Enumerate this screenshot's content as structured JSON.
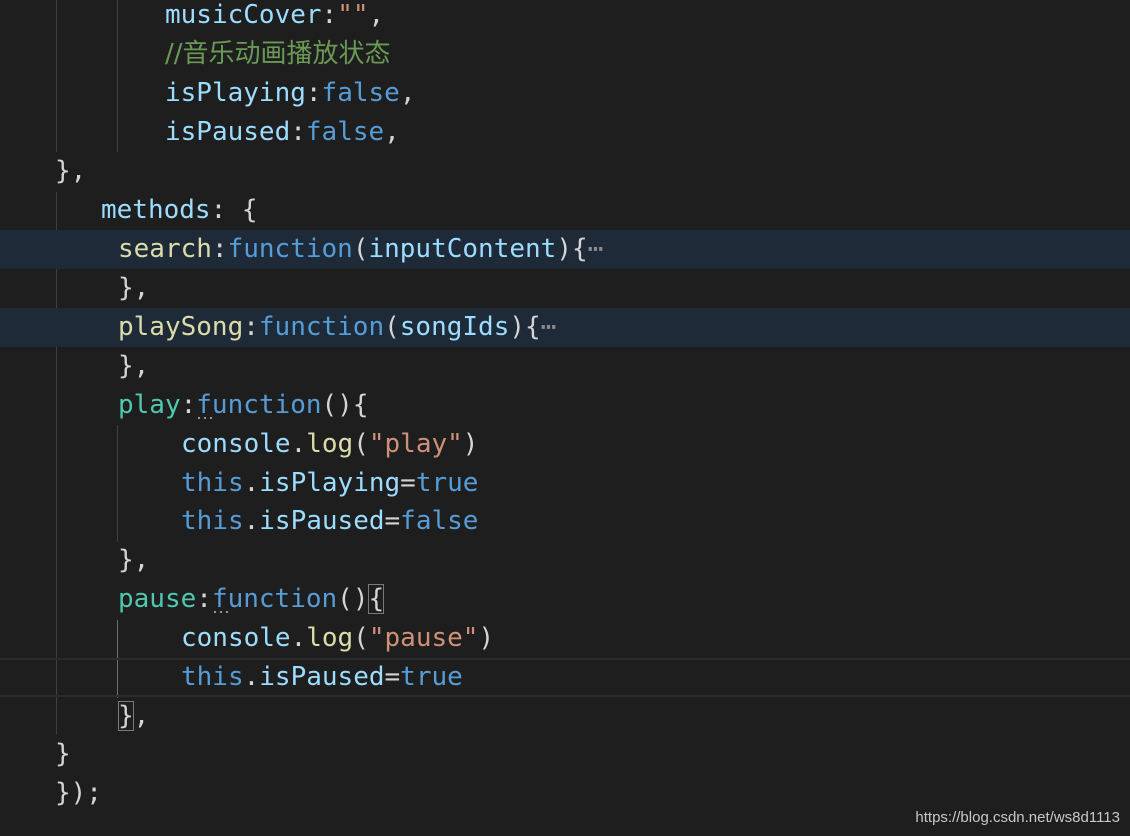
{
  "editor": {
    "lines": {
      "l1": {
        "key": "musicCover",
        "colon": ":",
        "str": "\"\"",
        "comma": ","
      },
      "l2": {
        "comment": "//音乐动画播放状态"
      },
      "l3": {
        "key": "isPlaying",
        "colon": ":",
        "value": "false",
        "comma": ","
      },
      "l4": {
        "key": "isPaused",
        "colon": ":",
        "value": "false",
        "comma": ","
      },
      "l5": {
        "text": "},"
      },
      "l6": {
        "key": "methods",
        "rest": ": {"
      },
      "l7": {
        "name": "search",
        "colon": ":",
        "kw": "function",
        "paren_open": "(",
        "param": "inputContent",
        "paren_close": "){",
        "fold": "⋯"
      },
      "l8": {
        "text": "},"
      },
      "l9": {
        "name": "playSong",
        "colon": ":",
        "kw": "function",
        "paren_open": "(",
        "param": "songIds",
        "paren_close": "){",
        "fold": "⋯"
      },
      "l10": {
        "text": "},"
      },
      "l11": {
        "name": "play",
        "colon": ":",
        "kw": "function",
        "rest": "(){"
      },
      "l12": {
        "obj": "console",
        "dot": ".",
        "method": "log",
        "open": "(",
        "str": "\"play\"",
        "close": ")"
      },
      "l13": {
        "this": "this",
        "dot": ".",
        "prop": "isPlaying",
        "eq": "=",
        "value": "true"
      },
      "l14": {
        "this": "this",
        "dot": ".",
        "prop": "isPaused",
        "eq": "=",
        "value": "false"
      },
      "l15": {
        "text": "},"
      },
      "l16": {
        "name": "pause",
        "colon": ":",
        "kw": "function",
        "paren": "()",
        "brace": "{"
      },
      "l17": {
        "obj": "console",
        "dot": ".",
        "method": "log",
        "open": "(",
        "str": "\"pause\"",
        "close": ")"
      },
      "l18": {
        "this": "this",
        "dot": ".",
        "prop": "isPaused",
        "eq": "=",
        "value": "true"
      },
      "l19": {
        "brace": "}",
        "comma": ","
      },
      "l20": {
        "text": "}"
      },
      "l21": {
        "text": "});"
      }
    }
  },
  "watermark": "https://blog.csdn.net/ws8d1113",
  "colors": {
    "background": "#1e1e1e",
    "property": "#9cdcfe",
    "keyword": "#569cd6",
    "string": "#ce9178",
    "comment": "#6a9955",
    "method": "#dcdcaa",
    "function_name": "#4ec9b0",
    "highlight": "#1f2a38"
  }
}
